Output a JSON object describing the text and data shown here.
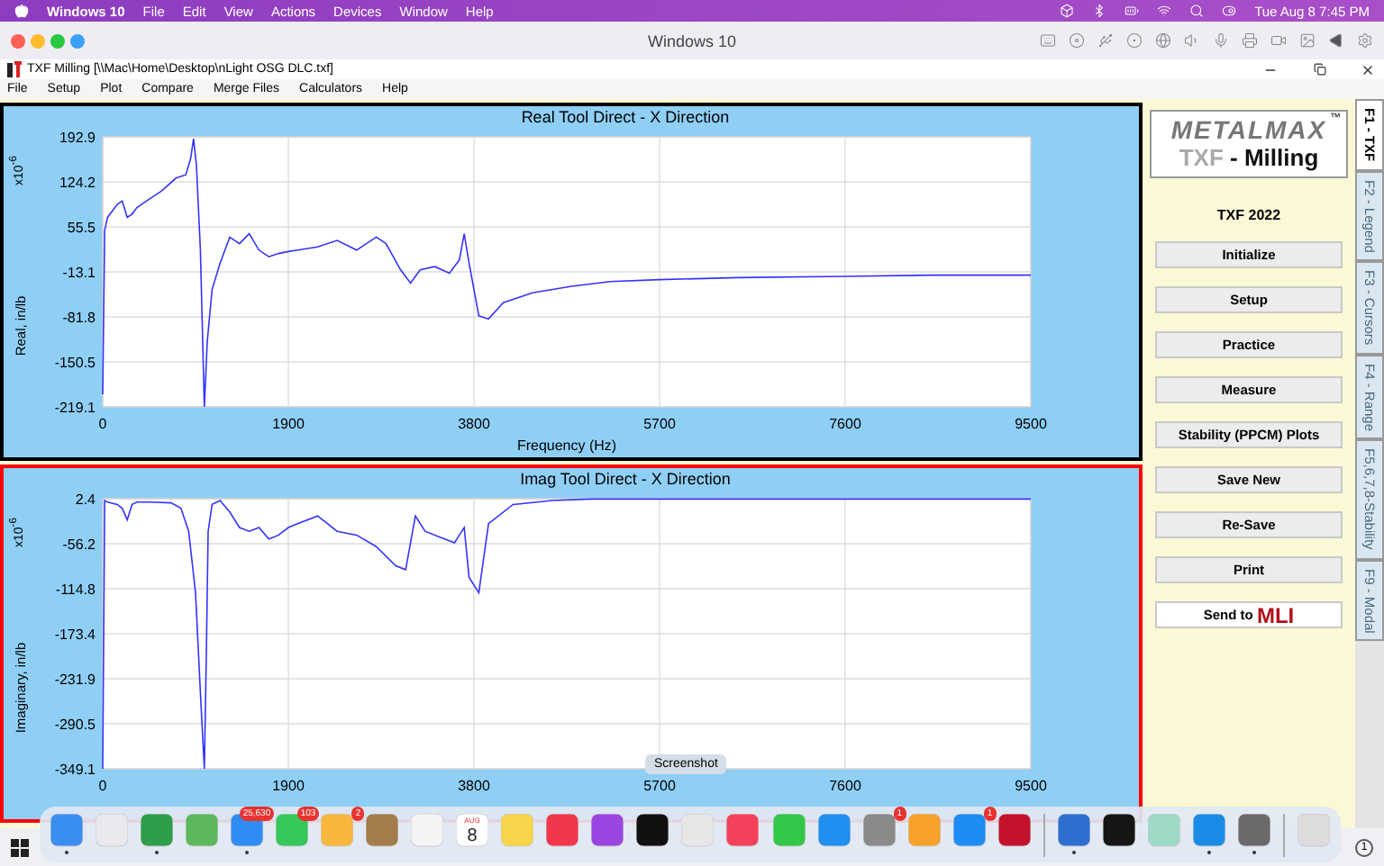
{
  "mac_menu_bar": {
    "app": "Windows 10",
    "menus": [
      "File",
      "Edit",
      "View",
      "Actions",
      "Devices",
      "Window",
      "Help"
    ],
    "clock": "Tue Aug 8  7:45 PM"
  },
  "vm_window": {
    "title": "Windows 10"
  },
  "app_window": {
    "title": "TXF Milling [\\\\Mac\\Home\\Desktop\\nLight OSG DLC.txf]",
    "menus": [
      "File",
      "Setup",
      "Plot",
      "Compare",
      "Merge Files",
      "Calculators",
      "Help"
    ]
  },
  "charts": [
    {
      "selected": false,
      "exponent": "x10$^{-6}$",
      "chart_data": {
        "type": "line",
        "grid": true,
        "title": "Real Tool Direct - X Direction",
        "xlabel": "Frequency (Hz)",
        "ylabel": "Real, in/lb",
        "x": [
          0,
          20,
          50,
          100,
          150,
          200,
          250,
          300,
          350,
          450,
          600,
          750,
          850,
          900,
          930,
          960,
          1000,
          1040,
          1070,
          1120,
          1200,
          1300,
          1400,
          1500,
          1600,
          1700,
          1800,
          1900,
          2000,
          2200,
          2400,
          2600,
          2800,
          2900,
          3050,
          3150,
          3250,
          3400,
          3550,
          3650,
          3700,
          3750,
          3850,
          3950,
          4100,
          4400,
          4800,
          5200,
          5700,
          6500,
          7600,
          8500,
          9500
        ],
        "series": [
          {
            "color": "#3333ff",
            "values": [
              -200,
              50,
              70,
              80,
              90,
              95,
              70,
              75,
              85,
              95,
              110,
              130,
              135,
              160,
              190,
              150,
              20,
              -219,
              -120,
              -40,
              0,
              40,
              30,
              45,
              20,
              10,
              15,
              18,
              20,
              25,
              35,
              20,
              40,
              30,
              -10,
              -30,
              -10,
              -5,
              -15,
              5,
              45,
              0,
              -80,
              -85,
              -60,
              -45,
              -35,
              -28,
              -25,
              -22,
              -20,
              -18,
              -18
            ]
          }
        ],
        "xlim": [
          0,
          9500
        ],
        "ylim": [
          -219.1,
          192.9
        ],
        "xticks": [
          0,
          1900,
          3800,
          5700,
          7600,
          9500
        ],
        "yticks": [
          192.9,
          124.2,
          55.5,
          -13.1,
          -81.8,
          -150.5,
          -219.1
        ]
      }
    },
    {
      "selected": true,
      "exponent": "x10$^{-6}$",
      "chart_data": {
        "type": "line",
        "grid": true,
        "title": "Imag Tool Direct - X Direction",
        "ylabel": "Imaginary, in/lb",
        "x": [
          0,
          20,
          50,
          150,
          200,
          250,
          300,
          350,
          500,
          700,
          800,
          880,
          950,
          1000,
          1040,
          1060,
          1080,
          1120,
          1200,
          1300,
          1400,
          1500,
          1600,
          1700,
          1800,
          1900,
          2000,
          2200,
          2400,
          2600,
          2800,
          3000,
          3100,
          3200,
          3300,
          3500,
          3600,
          3650,
          3700,
          3750,
          3850,
          3950,
          4200,
          4600,
          5000,
          5700,
          7600,
          9500
        ],
        "series": [
          {
            "color": "#3333ff",
            "values": [
              -349,
              0,
              -2,
              -5,
              -10,
              -25,
              -5,
              -2,
              -2,
              -3,
              -10,
              -40,
              -120,
              -250,
              -349,
              -200,
              -40,
              -5,
              0,
              -15,
              -35,
              -40,
              -35,
              -50,
              -45,
              -35,
              -30,
              -20,
              -40,
              -45,
              -60,
              -85,
              -90,
              -20,
              -40,
              -50,
              -55,
              -45,
              -35,
              -100,
              -120,
              -30,
              -5,
              0,
              2,
              2,
              2,
              2
            ]
          }
        ],
        "xlim": [
          0,
          9500
        ],
        "ylim": [
          -349.1,
          2.4
        ],
        "xticks": [
          0,
          1900,
          3800,
          5700,
          7600,
          9500
        ],
        "yticks": [
          2.4,
          -56.2,
          -114.8,
          -173.4,
          -231.9,
          -290.5,
          -349.1
        ]
      }
    }
  ],
  "side_panel": {
    "logo_top": "METALMAX",
    "logo_tm": "™",
    "logo_txf": "TXF",
    "logo_milling": " - Milling",
    "version": "TXF 2022",
    "buttons": [
      {
        "label": "Initialize",
        "kind": "plain"
      },
      {
        "label": "Setup",
        "kind": "plain"
      },
      {
        "label": "Practice",
        "kind": "plain"
      },
      {
        "label": "Measure",
        "kind": "plain"
      },
      {
        "label": "Stability (PPCM) Plots",
        "kind": "plain"
      },
      {
        "label": "Save New",
        "kind": "plain"
      },
      {
        "label": "Re-Save",
        "kind": "plain"
      },
      {
        "label": "Print",
        "kind": "plain"
      },
      {
        "label": "Send to ",
        "brand": "MLI",
        "kind": "brand"
      }
    ]
  },
  "side_tabs": [
    {
      "label": "F1 - TXF",
      "selected": true
    },
    {
      "label": "F2 - Legend",
      "selected": false
    },
    {
      "label": "F3 - Cursors",
      "selected": false
    },
    {
      "label": "F4 - Range",
      "selected": false
    },
    {
      "label": "F5,6,7,8-Stability",
      "selected": false
    },
    {
      "label": "F9 - Modal",
      "selected": false
    }
  ],
  "dock": {
    "tooltip": "Screenshot",
    "items": [
      {
        "kind": "app",
        "color": "#3a8ef0",
        "running": true
      },
      {
        "kind": "app",
        "color": "#e8e8ee",
        "running": false
      },
      {
        "kind": "app",
        "color": "#2e9e4a",
        "running": true
      },
      {
        "kind": "app",
        "color": "#5cb85c",
        "running": false
      },
      {
        "kind": "app",
        "color": "#2f8cf2",
        "running": true,
        "badge": "25,630"
      },
      {
        "kind": "app",
        "color": "#35c759",
        "running": false,
        "badge": "103"
      },
      {
        "kind": "app",
        "color": "#f6b73c",
        "running": false,
        "badge": "2"
      },
      {
        "kind": "app",
        "color": "#a47b4a",
        "running": false
      },
      {
        "kind": "app",
        "color": "#f4f4f4",
        "running": false
      },
      {
        "kind": "calendar",
        "color": "#ffffff",
        "running": false,
        "month": "AUG",
        "day": "8"
      },
      {
        "kind": "app",
        "color": "#f7d54a",
        "running": false
      },
      {
        "kind": "app",
        "color": "#f2374a",
        "running": false
      },
      {
        "kind": "app",
        "color": "#9b45e0",
        "running": false
      },
      {
        "kind": "app",
        "color": "#111111",
        "running": false
      },
      {
        "kind": "app",
        "color": "#e6e6e6",
        "running": false
      },
      {
        "kind": "app",
        "color": "#f5405a",
        "running": false
      },
      {
        "kind": "app",
        "color": "#33c748",
        "running": false
      },
      {
        "kind": "app",
        "color": "#1f8ff0",
        "running": false
      },
      {
        "kind": "app",
        "color": "#8a8a8a",
        "running": false,
        "badge": "1"
      },
      {
        "kind": "app",
        "color": "#f7a12a",
        "running": false
      },
      {
        "kind": "app",
        "color": "#1e8cf5",
        "running": false,
        "badge": "1"
      },
      {
        "kind": "app",
        "color": "#c4122e",
        "running": false
      },
      {
        "kind": "separator"
      },
      {
        "kind": "app",
        "color": "#2c6fd1",
        "running": true
      },
      {
        "kind": "app",
        "color": "#151515",
        "running": false
      },
      {
        "kind": "app",
        "color": "#9fd9c8",
        "running": false
      },
      {
        "kind": "app",
        "color": "#1a8ce8",
        "running": true
      },
      {
        "kind": "app",
        "color": "#6a6a6a",
        "running": true
      },
      {
        "kind": "separator"
      },
      {
        "kind": "app",
        "color": "#dcdcdc",
        "running": false
      }
    ]
  },
  "taskbar": {
    "notification_count": "1"
  }
}
